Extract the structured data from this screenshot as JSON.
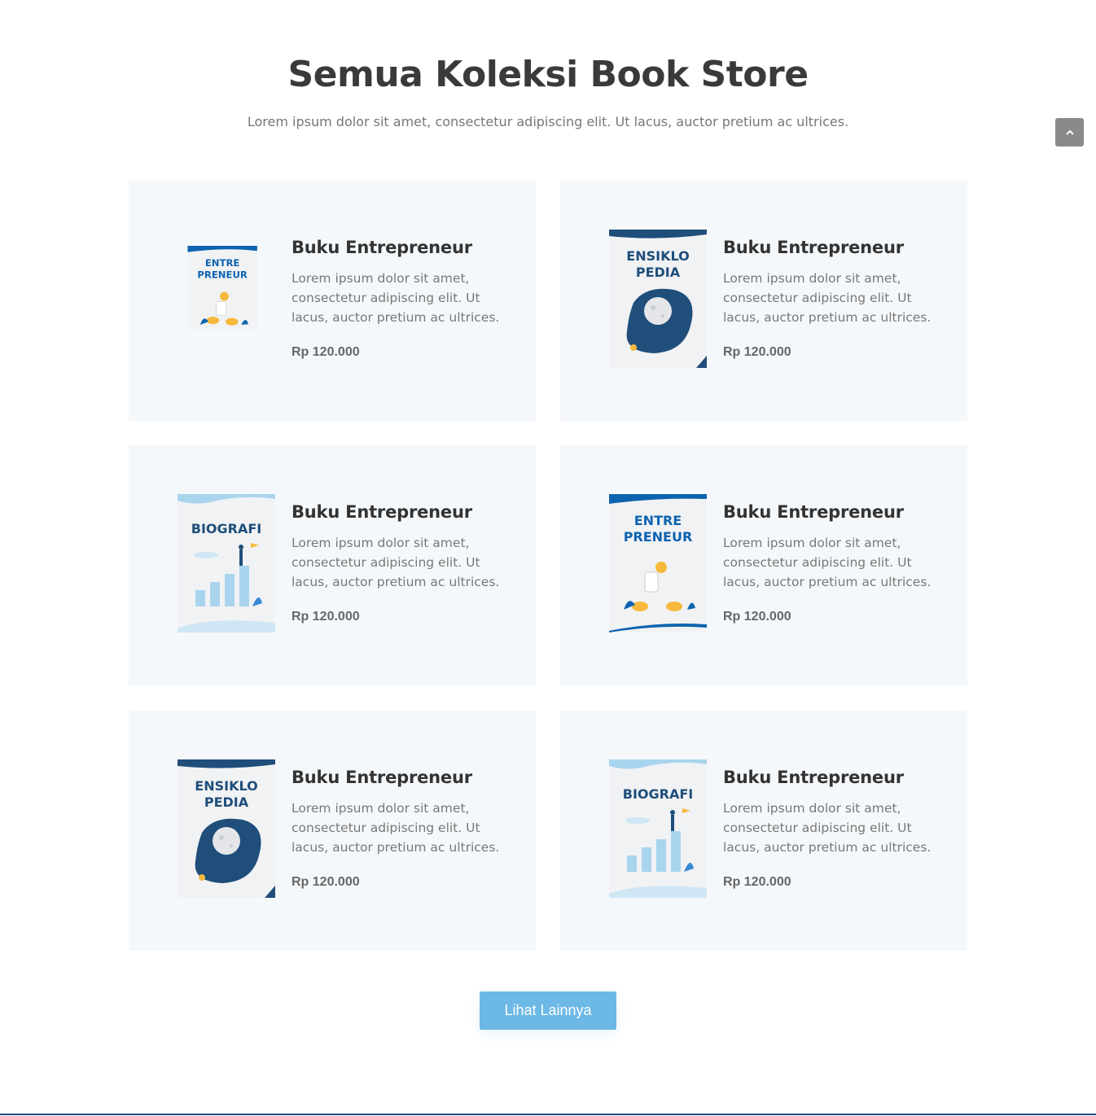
{
  "header": {
    "title": "Semua Koleksi Book Store",
    "subtitle": "Lorem ipsum dolor sit amet, consectetur adipiscing elit. Ut lacus, auctor pretium ac ultrices."
  },
  "products": [
    {
      "cover": "entrepreneur",
      "cover_text_1": "ENTRE",
      "cover_text_2": "PRENEUR",
      "title": "Buku Entrepreneur",
      "desc": "Lorem ipsum dolor sit amet, consectetur adipiscing elit. Ut lacus, auctor pretium ac ultrices.",
      "price": "Rp 120.000"
    },
    {
      "cover": "ensiklopedia",
      "cover_text_1": "ENSIKLO",
      "cover_text_2": "PEDIA",
      "title": "Buku Entrepreneur",
      "desc": "Lorem ipsum dolor sit amet, consectetur adipiscing elit. Ut lacus, auctor pretium ac ultrices.",
      "price": "Rp 120.000"
    },
    {
      "cover": "biografi",
      "cover_text_1": "BIOGRAFI",
      "cover_text_2": "",
      "title": "Buku Entrepreneur",
      "desc": "Lorem ipsum dolor sit amet, consectetur adipiscing elit. Ut lacus, auctor pretium ac ultrices.",
      "price": "Rp 120.000"
    },
    {
      "cover": "entrepreneur",
      "cover_text_1": "ENTRE",
      "cover_text_2": "PRENEUR",
      "title": "Buku Entrepreneur",
      "desc": "Lorem ipsum dolor sit amet, consectetur adipiscing elit. Ut lacus, auctor pretium ac ultrices.",
      "price": "Rp 120.000"
    },
    {
      "cover": "ensiklopedia",
      "cover_text_1": "ENSIKLO",
      "cover_text_2": "PEDIA",
      "title": "Buku Entrepreneur",
      "desc": "Lorem ipsum dolor sit amet, consectetur adipiscing elit. Ut lacus, auctor pretium ac ultrices.",
      "price": "Rp 120.000"
    },
    {
      "cover": "biografi",
      "cover_text_1": "BIOGRAFI",
      "cover_text_2": "",
      "title": "Buku Entrepreneur",
      "desc": "Lorem ipsum dolor sit amet, consectetur adipiscing elit. Ut lacus, auctor pretium ac ultrices.",
      "price": "Rp 120.000"
    }
  ],
  "more_button": {
    "label": "Lihat Lainnya"
  },
  "scroll_top": {
    "icon": "chevron-up-icon"
  },
  "colors": {
    "accent": "#6cb8e6",
    "card_bg": "#f5f8fb",
    "dark_blue": "#1f4e7a",
    "cover_blue": "#0d63b0"
  }
}
